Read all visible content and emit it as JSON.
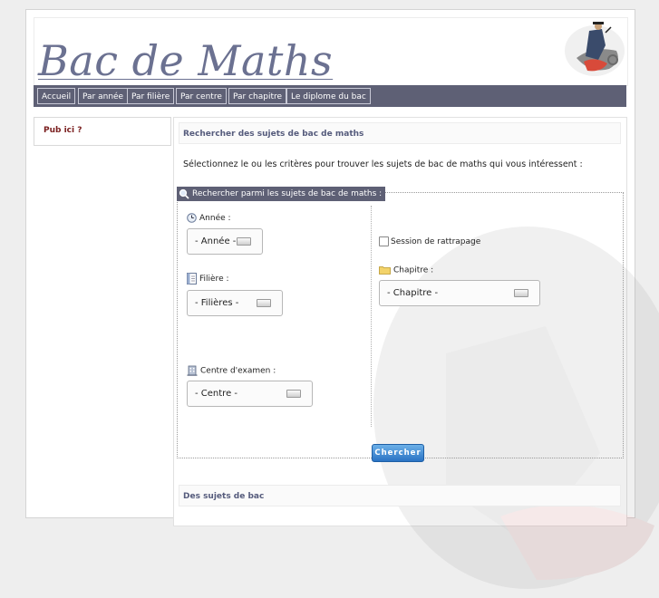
{
  "header": {
    "title": "Bac de Maths"
  },
  "nav": {
    "items": [
      "Accueil",
      "Par année",
      "Par filière",
      "Par centre",
      "Par chapitre",
      "Le diplome du bac"
    ]
  },
  "sidebar": {
    "pub_label": "Pub ici ?"
  },
  "main": {
    "section_title": "Rechercher des sujets de bac de maths",
    "intro": "Sélectionnez le ou les critères pour trouver les sujets de bac de maths qui vous intéressent :",
    "fieldset_legend": "Rechercher parmi les sujets de bac de maths :",
    "annee": {
      "label": "Année :",
      "value": "- Année -"
    },
    "filiere": {
      "label": "Filière :",
      "value": "- Filières -"
    },
    "centre": {
      "label": "Centre d'examen :",
      "value": "- Centre -"
    },
    "rattrapage": {
      "label": "Session de rattrapage"
    },
    "chapitre": {
      "label": "Chapitre :",
      "value": "- Chapitre -"
    },
    "search_button": "Chercher",
    "section2_title": "Des sujets de bac"
  },
  "icons": {
    "legend": "search-icon",
    "annee": "clock-icon",
    "filiere": "document-icon",
    "centre": "building-icon",
    "chapitre": "folder-icon"
  },
  "colors": {
    "nav_bg": "#5e6075",
    "title": "#6b7191",
    "button": "#2a73c4",
    "pub": "#7a1e1e"
  }
}
